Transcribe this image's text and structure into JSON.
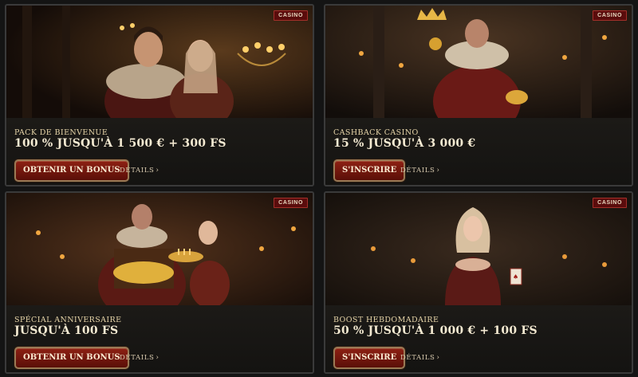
{
  "cards": [
    {
      "badge": "CASINO",
      "kicker": "PACK DE BIENVENUE",
      "headline": "100 % JUSQU'À 1 500 € + 300 FS",
      "cta": "OBTENIR UN BONUS",
      "details": "DÉTAILS",
      "chevron": "›",
      "image": "royal-couple-throne-room"
    },
    {
      "badge": "CASINO",
      "kicker": "CASHBACK CASINO",
      "headline": "15 % JUSQU'À 3 000 €",
      "cta": "S'INSCRIRE",
      "details": "DÉTAILS",
      "chevron": "›",
      "image": "king-holding-crown-and-gold"
    },
    {
      "badge": "CASINO",
      "kicker": "SPÉCIAL ANNIVERSAIRE",
      "headline": "JUSQU'À 100 FS",
      "cta": "OBTENIR UN BONUS",
      "details": "DÉTAILS",
      "chevron": "›",
      "image": "treasure-chest-and-birthday-cake"
    },
    {
      "badge": "CASINO",
      "kicker": "BOOST HEBDOMADAIRE",
      "headline": "50 % JUSQU'À 1 000 € + 100 FS",
      "cta": "S'INSCRIRE",
      "details": "DÉTAILS",
      "chevron": "›",
      "image": "queen-with-playing-card"
    }
  ],
  "colors": {
    "page_bg": "#141414",
    "card_border": "#3a3a3a",
    "button_red": "#8d2013",
    "button_border": "#9a7a55",
    "text_gold": "#e6d4a8",
    "badge_bg": "#5a0c0c"
  }
}
